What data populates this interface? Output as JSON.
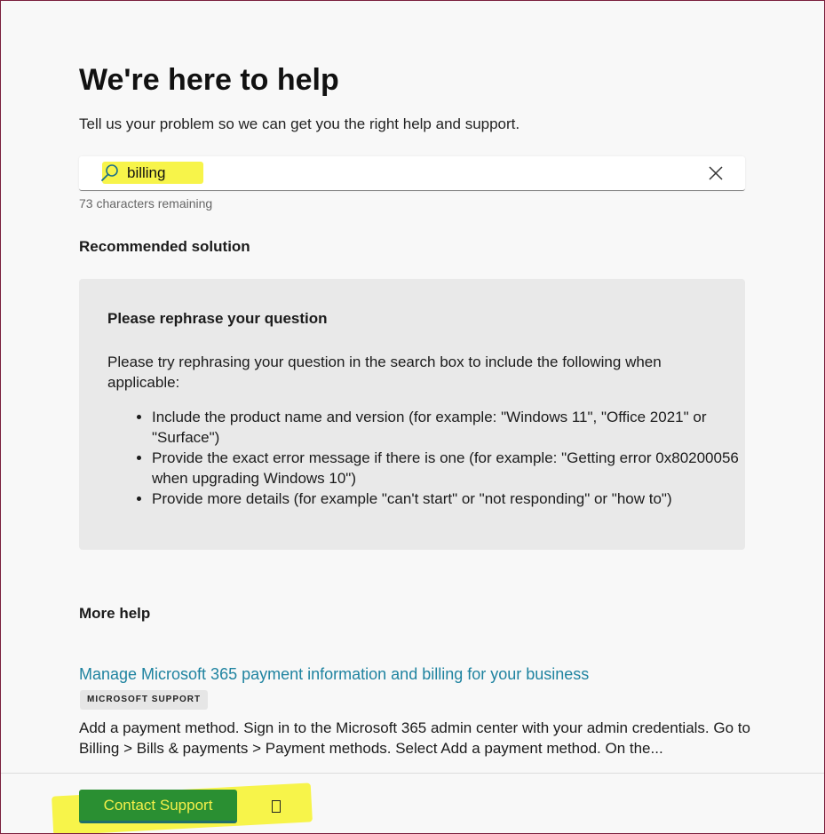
{
  "header": {
    "title": "We're here to help",
    "subtitle": "Tell us your problem so we can get you the right help and support."
  },
  "search": {
    "value": "billing",
    "placeholder": "",
    "char_count": "73 characters remaining"
  },
  "recommended": {
    "heading": "Recommended solution",
    "card_title": "Please rephrase your question",
    "intro": "Please try rephrasing your question in the search box to include the following when applicable:",
    "items": [
      "Include the product name and version (for example: \"Windows 11\", \"Office 2021\" or \"Surface\")",
      "Provide the exact error message if there is one (for example: \"Getting error 0x80200056 when upgrading Windows 10\")",
      "Provide more details (for example \"can't start\" or \"not responding\" or \"how to\")"
    ]
  },
  "more_help": {
    "heading": "More help",
    "result_title": "Manage Microsoft 365 payment information and billing for your business",
    "result_source": "MICROSOFT SUPPORT",
    "result_snippet": "Add a payment method. Sign in to the Microsoft 365 admin center with your admin credentials. Go to Billing > Bills & payments > Payment methods. Select Add a payment method. On the..."
  },
  "footer": {
    "contact_label": "Contact Support"
  },
  "colors": {
    "highlight": "#f7f44a",
    "link": "#1f83a0",
    "button": "#2a8f32",
    "frame_border": "#7a1f3d"
  },
  "icons": [
    "search-icon",
    "close-icon",
    "missing-glyph-icon"
  ]
}
